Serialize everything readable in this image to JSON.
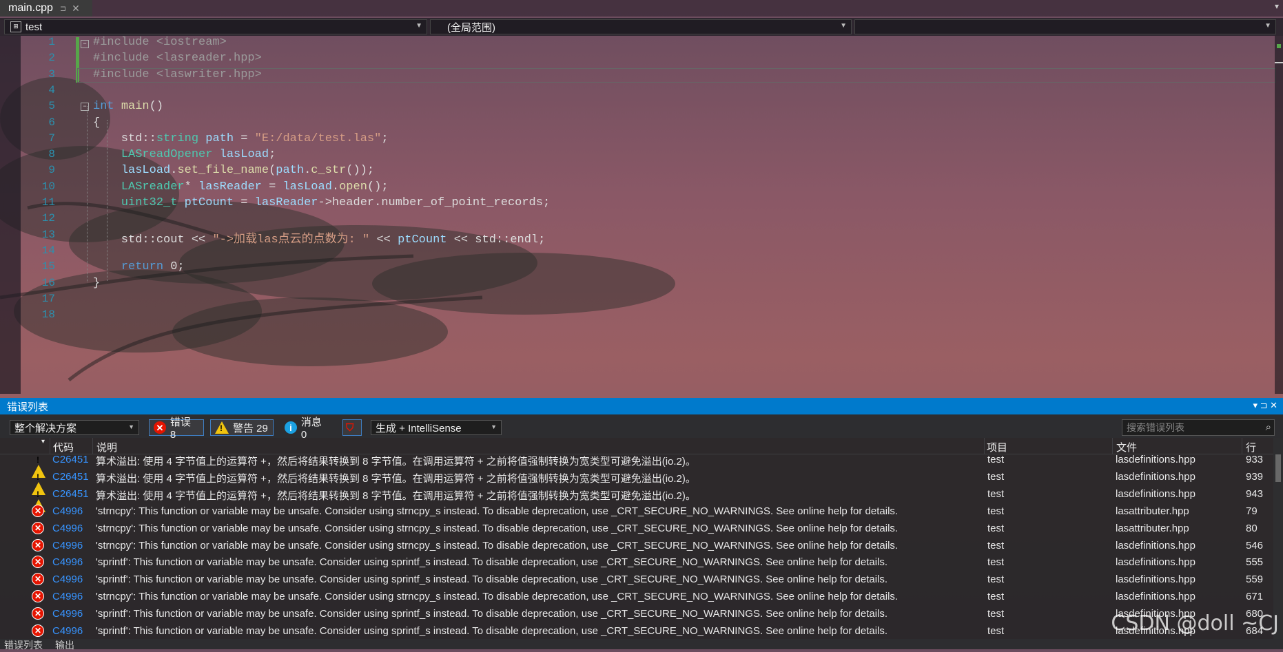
{
  "tab": {
    "filename": "main.cpp",
    "pin": "⊐",
    "close": "✕"
  },
  "nav": {
    "project": "test",
    "scope": "(全局范围)",
    "member": ""
  },
  "code": {
    "lines": [
      {
        "n": "1",
        "tokens": [
          {
            "c": "pp",
            "t": "#include <iostream>"
          }
        ]
      },
      {
        "n": "2",
        "tokens": [
          {
            "c": "pp",
            "t": "#include <lasreader.hpp>"
          }
        ]
      },
      {
        "n": "3",
        "tokens": [
          {
            "c": "pp",
            "t": "#include <laswriter.hpp>"
          }
        ]
      },
      {
        "n": "4",
        "tokens": []
      },
      {
        "n": "5",
        "tokens": [
          {
            "c": "kw",
            "t": "int"
          },
          {
            "c": "plain",
            "t": " "
          },
          {
            "c": "fn",
            "t": "main"
          },
          {
            "c": "plain",
            "t": "()"
          }
        ]
      },
      {
        "n": "6",
        "tokens": [
          {
            "c": "plain",
            "t": "{"
          }
        ]
      },
      {
        "n": "7",
        "tokens": [
          {
            "c": "plain",
            "t": "    std::"
          },
          {
            "c": "ty",
            "t": "string"
          },
          {
            "c": "plain",
            "t": " "
          },
          {
            "c": "id",
            "t": "path"
          },
          {
            "c": "plain",
            "t": " = "
          },
          {
            "c": "str",
            "t": "\"E:/data/test.las\""
          },
          {
            "c": "plain",
            "t": ";"
          }
        ]
      },
      {
        "n": "8",
        "tokens": [
          {
            "c": "plain",
            "t": "    "
          },
          {
            "c": "ty",
            "t": "LASreadOpener"
          },
          {
            "c": "plain",
            "t": " "
          },
          {
            "c": "id",
            "t": "lasLoad"
          },
          {
            "c": "plain",
            "t": ";"
          }
        ]
      },
      {
        "n": "9",
        "tokens": [
          {
            "c": "plain",
            "t": "    "
          },
          {
            "c": "id",
            "t": "lasLoad"
          },
          {
            "c": "plain",
            "t": "."
          },
          {
            "c": "fn",
            "t": "set_file_name"
          },
          {
            "c": "plain",
            "t": "("
          },
          {
            "c": "id",
            "t": "path"
          },
          {
            "c": "plain",
            "t": "."
          },
          {
            "c": "fn",
            "t": "c_str"
          },
          {
            "c": "plain",
            "t": "());"
          }
        ]
      },
      {
        "n": "10",
        "tokens": [
          {
            "c": "plain",
            "t": "    "
          },
          {
            "c": "ty",
            "t": "LASreader"
          },
          {
            "c": "plain",
            "t": "* "
          },
          {
            "c": "id",
            "t": "lasReader"
          },
          {
            "c": "plain",
            "t": " = "
          },
          {
            "c": "id",
            "t": "lasLoad"
          },
          {
            "c": "plain",
            "t": "."
          },
          {
            "c": "fn",
            "t": "open"
          },
          {
            "c": "plain",
            "t": "();"
          }
        ]
      },
      {
        "n": "11",
        "tokens": [
          {
            "c": "plain",
            "t": "    "
          },
          {
            "c": "ty",
            "t": "uint32_t"
          },
          {
            "c": "plain",
            "t": " "
          },
          {
            "c": "id",
            "t": "ptCount"
          },
          {
            "c": "plain",
            "t": " = "
          },
          {
            "c": "id",
            "t": "lasReader"
          },
          {
            "c": "plain",
            "t": "->header.number_of_point_records;"
          }
        ]
      },
      {
        "n": "12",
        "tokens": []
      },
      {
        "n": "13",
        "tokens": [
          {
            "c": "plain",
            "t": "    std::cout << "
          },
          {
            "c": "str",
            "t": "\"->加载las点云的点数为: \""
          },
          {
            "c": "plain",
            "t": " << "
          },
          {
            "c": "id",
            "t": "ptCount"
          },
          {
            "c": "plain",
            "t": " << std::endl;"
          }
        ]
      },
      {
        "n": "14",
        "tokens": []
      },
      {
        "n": "15",
        "tokens": [
          {
            "c": "plain",
            "t": "    "
          },
          {
            "c": "kw",
            "t": "return"
          },
          {
            "c": "plain",
            "t": " 0;"
          }
        ]
      },
      {
        "n": "16",
        "tokens": [
          {
            "c": "plain",
            "t": "}"
          }
        ]
      },
      {
        "n": "17",
        "tokens": []
      },
      {
        "n": "18",
        "tokens": []
      }
    ]
  },
  "errorlist": {
    "title": "错误列表",
    "scope_dropdown": "整个解决方案",
    "errors_label": "错误 8",
    "warnings_label": "警告 29",
    "messages_label": "消息 0",
    "build_dropdown": "生成 + IntelliSense",
    "search_placeholder": "搜索错误列表",
    "columns": {
      "code": "代码",
      "desc": "说明",
      "project": "项目",
      "file": "文件",
      "line": "行"
    },
    "rows": [
      {
        "type": "warn",
        "code": "C26451",
        "desc": "算术溢出: 使用 4 字节值上的运算符 +，然后将结果转换到 8 字节值。在调用运算符 + 之前将值强制转换为宽类型可避免溢出(io.2)。",
        "project": "test",
        "file": "lasdefinitions.hpp",
        "line": "933"
      },
      {
        "type": "warn",
        "code": "C26451",
        "desc": "算术溢出: 使用 4 字节值上的运算符 +，然后将结果转换到 8 字节值。在调用运算符 + 之前将值强制转换为宽类型可避免溢出(io.2)。",
        "project": "test",
        "file": "lasdefinitions.hpp",
        "line": "939"
      },
      {
        "type": "warn",
        "code": "C26451",
        "desc": "算术溢出: 使用 4 字节值上的运算符 +，然后将结果转换到 8 字节值。在调用运算符 + 之前将值强制转换为宽类型可避免溢出(io.2)。",
        "project": "test",
        "file": "lasdefinitions.hpp",
        "line": "943"
      },
      {
        "type": "err",
        "code": "C4996",
        "desc": "'strncpy': This function or variable may be unsafe. Consider using strncpy_s instead. To disable deprecation, use _CRT_SECURE_NO_WARNINGS. See online help for details.",
        "project": "test",
        "file": "lasattributer.hpp",
        "line": "79"
      },
      {
        "type": "err",
        "code": "C4996",
        "desc": "'strncpy': This function or variable may be unsafe. Consider using strncpy_s instead. To disable deprecation, use _CRT_SECURE_NO_WARNINGS. See online help for details.",
        "project": "test",
        "file": "lasattributer.hpp",
        "line": "80"
      },
      {
        "type": "err",
        "code": "C4996",
        "desc": "'strncpy': This function or variable may be unsafe. Consider using strncpy_s instead. To disable deprecation, use _CRT_SECURE_NO_WARNINGS. See online help for details.",
        "project": "test",
        "file": "lasdefinitions.hpp",
        "line": "546"
      },
      {
        "type": "err",
        "code": "C4996",
        "desc": "'sprintf': This function or variable may be unsafe. Consider using sprintf_s instead. To disable deprecation, use _CRT_SECURE_NO_WARNINGS. See online help for details.",
        "project": "test",
        "file": "lasdefinitions.hpp",
        "line": "555"
      },
      {
        "type": "err",
        "code": "C4996",
        "desc": "'sprintf': This function or variable may be unsafe. Consider using sprintf_s instead. To disable deprecation, use _CRT_SECURE_NO_WARNINGS. See online help for details.",
        "project": "test",
        "file": "lasdefinitions.hpp",
        "line": "559"
      },
      {
        "type": "err",
        "code": "C4996",
        "desc": "'strncpy': This function or variable may be unsafe. Consider using strncpy_s instead. To disable deprecation, use _CRT_SECURE_NO_WARNINGS. See online help for details.",
        "project": "test",
        "file": "lasdefinitions.hpp",
        "line": "671"
      },
      {
        "type": "err",
        "code": "C4996",
        "desc": "'sprintf': This function or variable may be unsafe. Consider using sprintf_s instead. To disable deprecation, use _CRT_SECURE_NO_WARNINGS. See online help for details.",
        "project": "test",
        "file": "lasdefinitions.hpp",
        "line": "680"
      },
      {
        "type": "err",
        "code": "C4996",
        "desc": "'sprintf': This function or variable may be unsafe. Consider using sprintf_s instead. To disable deprecation, use _CRT_SECURE_NO_WARNINGS. See online help for details.",
        "project": "test",
        "file": "lasdefinitions.hpp",
        "line": "684"
      }
    ]
  },
  "bottom_tabs": {
    "errors": "错误列表",
    "output": "输出"
  },
  "watermark": "CSDN @doll ~CJ",
  "colors": {
    "accent": "#007acc",
    "error": "#e51400",
    "warning": "#f1c40f",
    "info": "#1ba1e2",
    "line_number": "#2b91af"
  }
}
